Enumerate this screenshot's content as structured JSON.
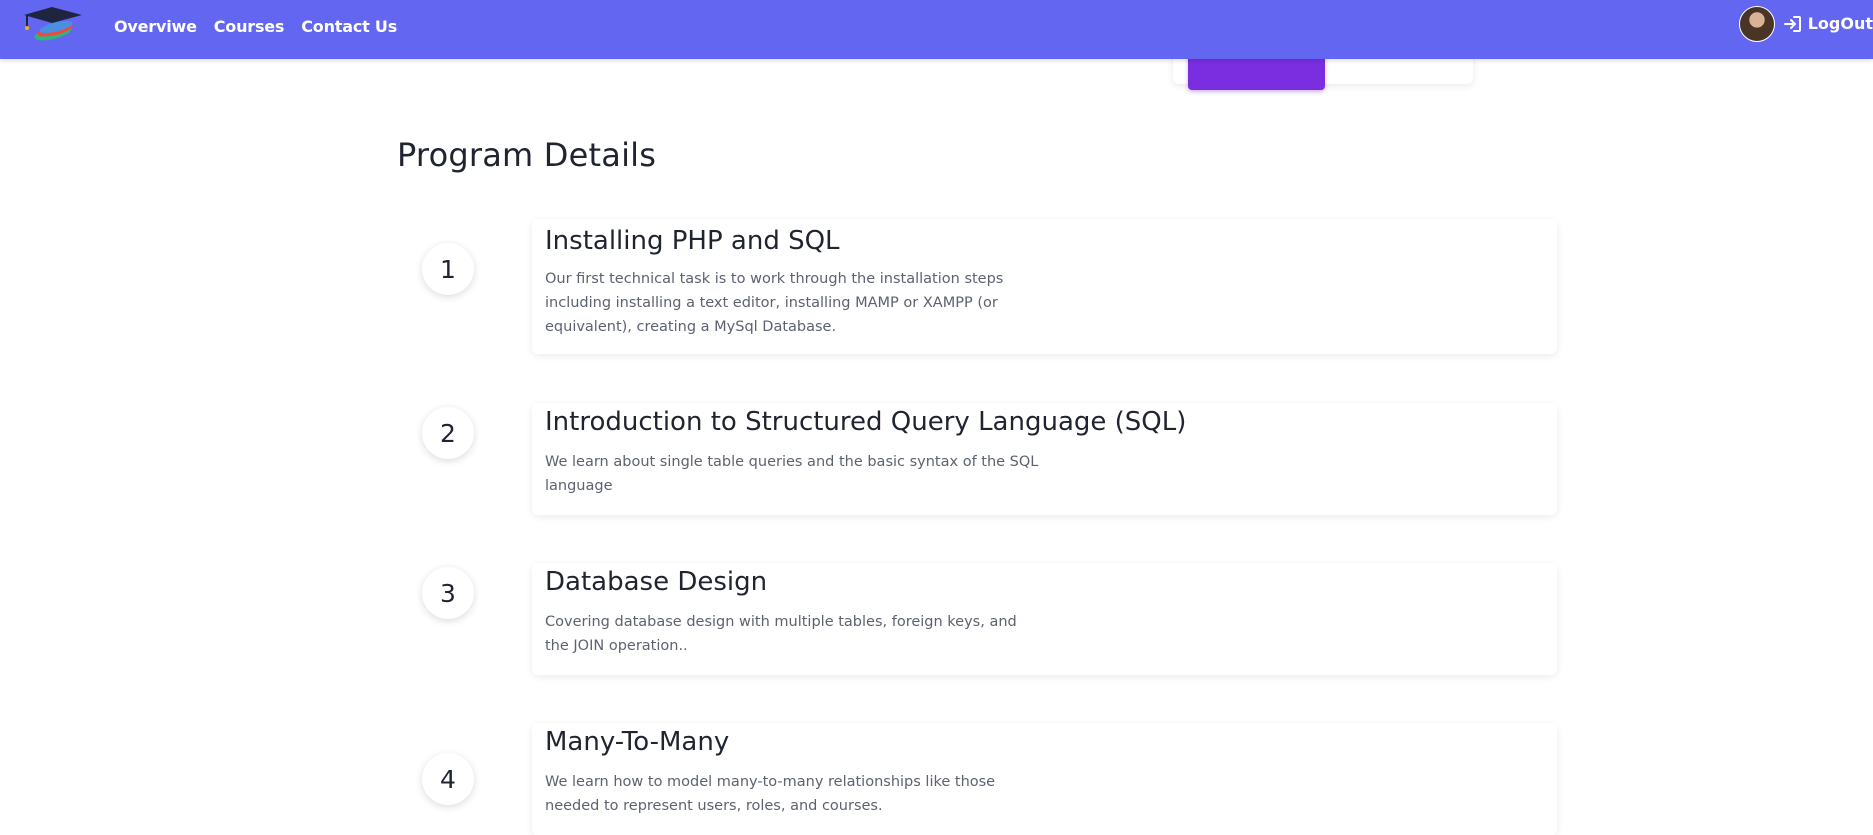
{
  "nav": {
    "links": [
      "Overviwe",
      "Courses",
      "Contact Us"
    ],
    "logout_label": "LogOut",
    "accent_color": "#6366f1"
  },
  "top_card": {
    "button_color": "#7a2ee0"
  },
  "program": {
    "title": "Program Details",
    "steps": [
      {
        "number": "1",
        "title": "Installing PHP and SQL",
        "description": "Our first technical task is to work through the installation steps including installing a text editor, installing MAMP or XAMPP (or equivalent), creating a MySql Database."
      },
      {
        "number": "2",
        "title": "Introduction to Structured Query Language (SQL)",
        "description": "We learn about single table queries and the basic syntax of the SQL language"
      },
      {
        "number": "3",
        "title": "Database Design",
        "description": "Covering database design with multiple tables, foreign keys, and the JOIN operation.."
      },
      {
        "number": "4",
        "title": "Many-To-Many",
        "description": "We learn how to model many-to-many relationships like those needed to represent users, roles, and courses."
      }
    ]
  }
}
